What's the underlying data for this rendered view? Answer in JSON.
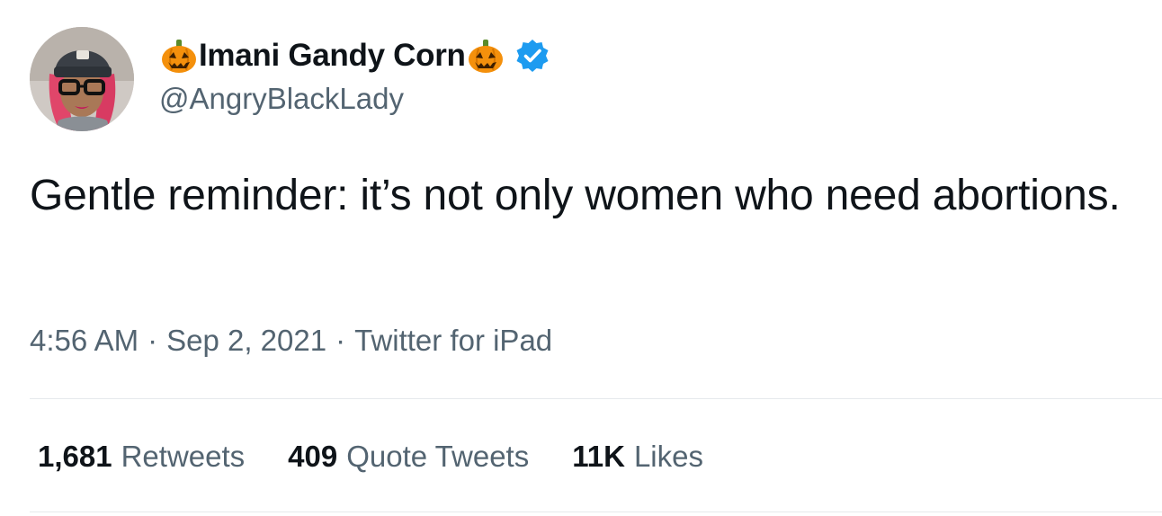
{
  "tweet": {
    "author": {
      "display_name": "Imani Gandy Corn",
      "name_prefix_emoji": "jack-o-lantern",
      "name_suffix_emoji": "jack-o-lantern",
      "handle": "@AngryBlackLady",
      "verified": true,
      "verified_color": "#1d9bf0"
    },
    "text": "Gentle reminder: it’s not only women who need abortions.",
    "meta": {
      "time": "4:56 AM",
      "separator": "·",
      "date": "Sep 2, 2021",
      "source": "Twitter for iPad"
    },
    "stats": {
      "retweets": {
        "count": "1,681",
        "label": "Retweets"
      },
      "quotes": {
        "count": "409",
        "label": "Quote Tweets"
      },
      "likes": {
        "count": "11K",
        "label": "Likes"
      }
    }
  }
}
